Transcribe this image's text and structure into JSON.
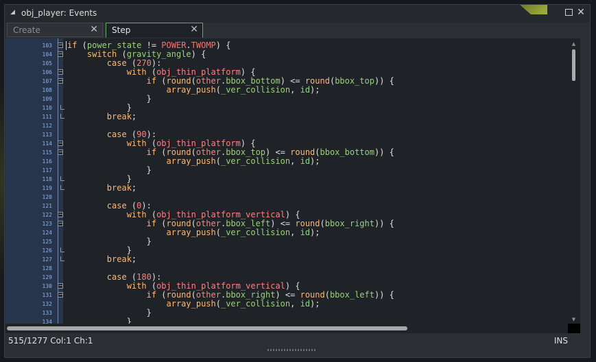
{
  "window": {
    "title": "obj_player: Events",
    "collapse_icon": "triangle-icon",
    "restore_icon": "restore-icon",
    "close_icon": "close-icon"
  },
  "tabs": [
    {
      "label": "Create",
      "active": false
    },
    {
      "label": "Step",
      "active": true
    }
  ],
  "editor": {
    "line_numbers": [
      "103",
      "104",
      "105",
      "106",
      "107",
      "108",
      "109",
      "110",
      "111",
      "112",
      "113",
      "114",
      "115",
      "116",
      "117",
      "118",
      "119",
      "120",
      "121",
      "122",
      "123",
      "124",
      "125",
      "126",
      "127",
      "128",
      "129",
      "130",
      "131",
      "132",
      "133",
      "134"
    ],
    "fold_markers": [
      "-",
      "-",
      "",
      "-",
      "-",
      "",
      "",
      "",
      "",
      "",
      "",
      "-",
      "-",
      "",
      "",
      "",
      "",
      "",
      "",
      "-",
      "-",
      "",
      "",
      "",
      "",
      "",
      "",
      "-",
      "-",
      "",
      "",
      " "
    ],
    "lines": [
      "if (power_state != POWER.TWOMP) {",
      "    switch (gravity_angle) {",
      "        case (270):",
      "            with (obj_thin_platform) {",
      "                if (round(other.bbox_bottom) <= round(bbox_top)) {",
      "                    array_push(_ver_collision, id);",
      "                }",
      "            }",
      "        break;",
      "",
      "        case (90):",
      "            with (obj_thin_platform) {",
      "                if (round(other.bbox_top) <= round(bbox_bottom)) {",
      "                    array_push(_ver_collision, id);",
      "                }",
      "            }",
      "        break;",
      "",
      "        case (0):",
      "            with (obj_thin_platform_vertical) {",
      "                if (round(other.bbox_left) <= round(bbox_right)) {",
      "                    array_push(_ver_collision, id);",
      "                }",
      "            }",
      "        break;",
      "",
      "        case (180):",
      "            with (obj_thin_platform_vertical) {",
      "                if (round(other.bbox_right) <= round(bbox_left)) {",
      "                    array_push(_ver_collision, id);",
      "                }",
      "            }"
    ]
  },
  "statusbar": {
    "position": "515/1277 Col:1 Ch:1",
    "mode": "INS"
  },
  "colors": {
    "gutter": "#26354b",
    "editor_bg": "#1f2226",
    "keyword": "#ffb871",
    "number": "#ff8080",
    "variable": "#9ad27b",
    "active_tab_border": "#5fae62"
  }
}
